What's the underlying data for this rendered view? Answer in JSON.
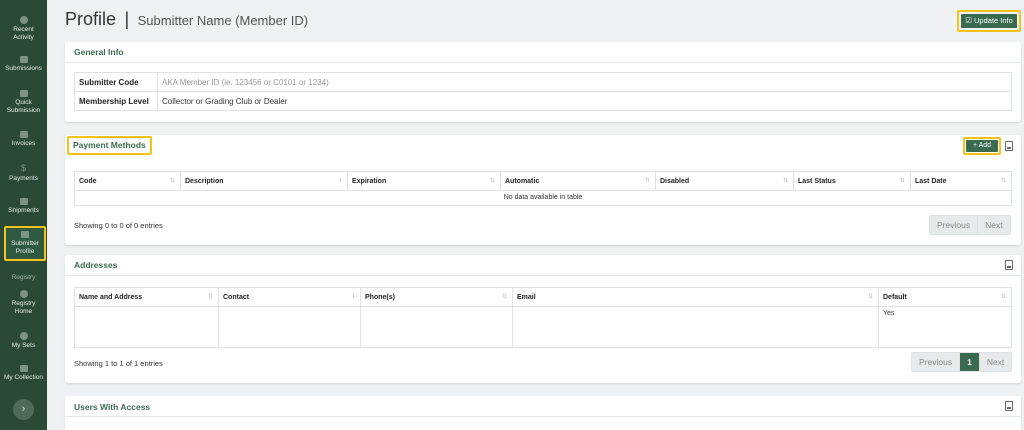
{
  "sidebar": {
    "items": [
      {
        "label1": "Recent",
        "label2": "Activity",
        "icon": "clock-icon"
      },
      {
        "label1": "Submissions",
        "label2": "",
        "icon": "document-icon"
      },
      {
        "label1": "Quick",
        "label2": "Submission",
        "icon": "folder-icon"
      },
      {
        "label1": "Invoices",
        "label2": "",
        "icon": "invoice-icon"
      },
      {
        "label1": "Payments",
        "label2": "",
        "icon": "dollar-icon"
      },
      {
        "label1": "Shipments",
        "label2": "",
        "icon": "box-icon"
      },
      {
        "label1": "Submitter",
        "label2": "Profile",
        "icon": "id-card-icon"
      },
      {
        "label1": "Registry Home",
        "label2": "",
        "icon": "home-icon"
      },
      {
        "label1": "My Sets",
        "label2": "",
        "icon": "sets-icon"
      },
      {
        "label1": "My Collection",
        "label2": "",
        "icon": "collection-icon"
      }
    ],
    "section_registry": "Registry",
    "registry_home_1": "Registry",
    "registry_home_2": "Home",
    "expand_glyph": "›"
  },
  "page": {
    "title": "Profile",
    "separator": "|",
    "subtitle": "Submitter Name (Member ID)",
    "update_button": "☑ Update Info"
  },
  "general_info": {
    "title": "General Info",
    "rows": [
      {
        "key": "Submitter Code",
        "value": "AKA Member ID (ie. 123456 or C0101 or 1234)"
      },
      {
        "key": "Membership Level",
        "value": "Collector or Grading Club or Dealer"
      }
    ]
  },
  "payment_methods": {
    "title": "Payment Methods",
    "add_button": "+ Add",
    "columns": [
      "Code",
      "Description",
      "Expiration",
      "Automatic",
      "Disabled",
      "Last Status",
      "Last Date"
    ],
    "empty_message": "No data available in table",
    "showing": "Showing 0 to 0 of 0 entries",
    "prev": "Previous",
    "next": "Next"
  },
  "addresses": {
    "title": "Addresses",
    "columns": [
      "Name and Address",
      "Contact",
      "Phone(s)",
      "Email",
      "Default"
    ],
    "rows": [
      {
        "name_address": "",
        "contact": "",
        "phones": "",
        "email": "",
        "default": "Yes"
      }
    ],
    "showing": "Showing 1 to 1 of 1 entries",
    "prev": "Previous",
    "page": "1",
    "next": "Next"
  },
  "users_with_access": {
    "title": "Users With Access"
  },
  "colors": {
    "sidebar_bg": "#2a4a37",
    "accent": "#3a6a50",
    "highlight": "#f5c21b"
  }
}
